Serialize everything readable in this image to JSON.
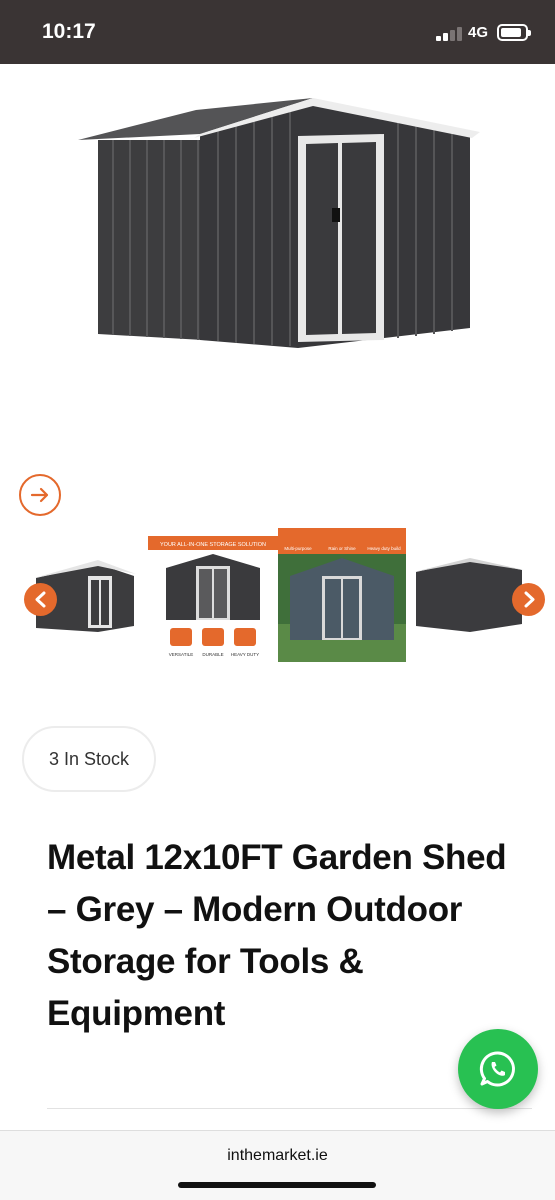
{
  "status_bar": {
    "time": "10:17",
    "network": "4G",
    "icons": [
      "cellular-signal-icon",
      "battery-icon"
    ]
  },
  "gallery": {
    "main_image": "metal-garden-shed-image",
    "next_icon": "arrow-right-icon",
    "prev_icon": "chevron-left-icon",
    "forward_icon": "chevron-right-icon",
    "accent_color": "#e4692c",
    "thumbnails": [
      {
        "name": "shed-front-thumbnail"
      },
      {
        "name": "storage-features-thumbnail",
        "banner": "YOUR ALL-IN-ONE STORAGE SOLUTION",
        "features": [
          "VERSATILE",
          "DURABLE",
          "HEAVY DUTY"
        ]
      },
      {
        "name": "outdoor-shed-thumbnail",
        "features": [
          "Multi-purpose",
          "Rain or Shine",
          "Heavy duty build"
        ]
      },
      {
        "name": "shed-side-thumbnail"
      }
    ]
  },
  "product": {
    "stock": "3 In Stock",
    "title": "Metal 12x10FT Garden Shed – Grey – Modern Outdoor Storage for Tools & Equipment"
  },
  "chat": {
    "icon": "whatsapp-icon",
    "color": "#28c152"
  },
  "browser": {
    "url": "inthemarket.ie"
  }
}
